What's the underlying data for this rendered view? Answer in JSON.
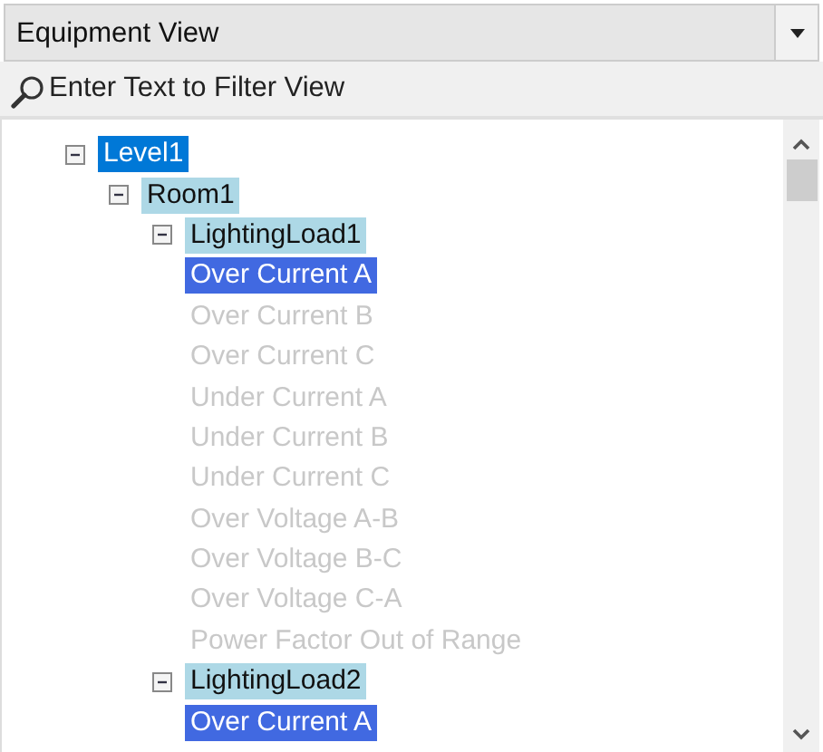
{
  "view_select": {
    "value": "Equipment View"
  },
  "filter": {
    "placeholder": "Enter Text to Filter View"
  },
  "tree": [
    {
      "label": "Level1",
      "kind": "group",
      "expanded": true,
      "selected": true,
      "children": [
        {
          "label": "Room1",
          "kind": "group",
          "expanded": true,
          "selected": false,
          "children": [
            {
              "label": "LightingLoad1",
              "kind": "group",
              "expanded": true,
              "selected": false,
              "children": [
                {
                  "label": "Over Current A",
                  "kind": "alarm",
                  "selected": true,
                  "disabled": false
                },
                {
                  "label": "Over Current B",
                  "kind": "alarm",
                  "selected": false,
                  "disabled": true
                },
                {
                  "label": "Over Current C",
                  "kind": "alarm",
                  "selected": false,
                  "disabled": true
                },
                {
                  "label": "Under Current A",
                  "kind": "alarm",
                  "selected": false,
                  "disabled": true
                },
                {
                  "label": "Under Current B",
                  "kind": "alarm",
                  "selected": false,
                  "disabled": true
                },
                {
                  "label": "Under Current C",
                  "kind": "alarm",
                  "selected": false,
                  "disabled": true
                },
                {
                  "label": "Over Voltage A-B",
                  "kind": "alarm",
                  "selected": false,
                  "disabled": true
                },
                {
                  "label": "Over Voltage B-C",
                  "kind": "alarm",
                  "selected": false,
                  "disabled": true
                },
                {
                  "label": "Over Voltage C-A",
                  "kind": "alarm",
                  "selected": false,
                  "disabled": true
                },
                {
                  "label": "Power Factor Out of Range",
                  "kind": "alarm",
                  "selected": false,
                  "disabled": true
                }
              ]
            },
            {
              "label": "LightingLoad2",
              "kind": "group",
              "expanded": true,
              "selected": false,
              "children": [
                {
                  "label": "Over Current A",
                  "kind": "alarm",
                  "selected": true,
                  "disabled": false
                }
              ]
            }
          ]
        }
      ]
    }
  ]
}
